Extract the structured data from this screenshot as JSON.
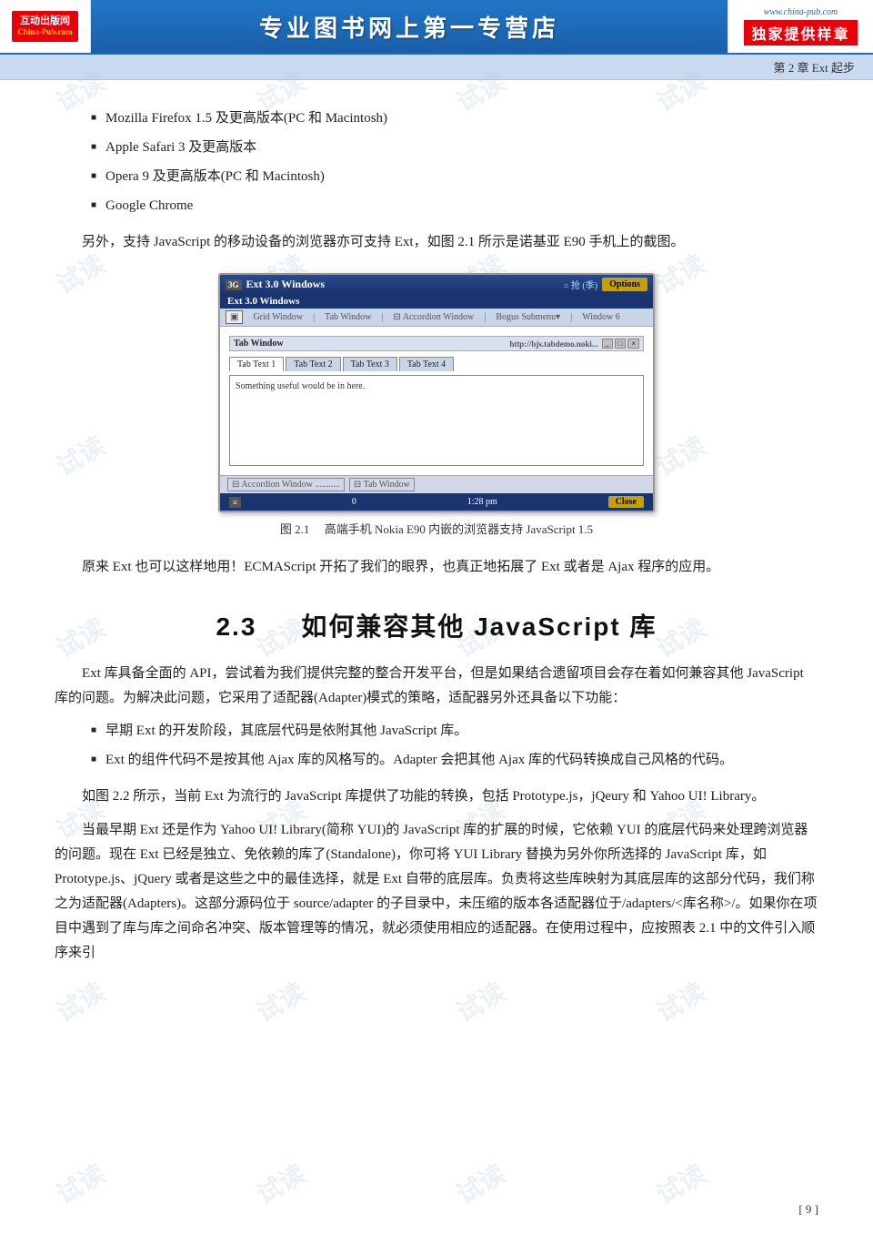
{
  "header": {
    "logo_line1": "互动出版网",
    "logo_line2": "China-Pub.com",
    "url": "www.china-pub.com",
    "title": "专业图书网上第一专营店",
    "slogan": "独家提供样章"
  },
  "chapter_bar": {
    "text": "第 2 章   Ext 起步"
  },
  "bullet_items": [
    "Mozilla Firefox 1.5 及更高版本(PC 和 Macintosh)",
    "Apple Safari 3 及更高版本",
    "Opera 9 及更高版本(PC 和 Macintosh)",
    "Google Chrome"
  ],
  "para1": "另外，支持 JavaScript 的移动设备的浏览器亦可支持 Ext，如图 2.1 所示是诺基亚 E90 手机上的截图。",
  "nokia": {
    "signal": "○ 抢 (季)",
    "title": "Ext 3.0 Windows",
    "options": "Options",
    "sub_header": "Ext 3.0 Windows",
    "nav_items": [
      "Grid Window",
      "Tab Window",
      "Accordion Window",
      "Bogus Submenu▾",
      "Window 6"
    ],
    "inner_title": "Tab Window",
    "url_bar": "http://bjs.tabdemo.noki...",
    "tabs": [
      "Tab Text 1",
      "Tab Text 2",
      "Tab Text 3",
      "Tab Text 4"
    ],
    "content": "Something useful would be in here.",
    "bottom_nav": [
      "Accordion Window",
      "Tab Window"
    ],
    "status_left": "0",
    "status_time": "1:28 pm",
    "close_btn": "Close"
  },
  "figure": {
    "label": "图 2.1",
    "caption": "高端手机 Nokia E90 内嵌的浏览器支持 JavaScript 1.5"
  },
  "para2": "原来 Ext 也可以这样地用！ECMAScript 开拓了我们的眼界，也真正地拓展了 Ext 或者是 Ajax 程序的应用。",
  "section": {
    "number": "2.3",
    "title": "如何兼容其他 JavaScript 库"
  },
  "para3": "Ext 库具备全面的 API，尝试着为我们提供完整的整合开发平台，但是如果结合遗留项目会存在着如何兼容其他 JavaScript 库的问题。为解决此问题，它采用了适配器(Adapter)模式的策略，适配器另外还具备以下功能：",
  "bullet2_items": [
    "早期 Ext 的开发阶段，其底层代码是依附其他 JavaScript 库。",
    "Ext 的组件代码不是按其他 Ajax 库的风格写的。Adapter 会把其他 Ajax 库的代码转换成自己风格的代码。"
  ],
  "para4": "如图 2.2 所示，当前 Ext 为流行的 JavaScript 库提供了功能的转换，包括 Prototype.js，jQeury 和 Yahoo UI! Library。",
  "para5": "当最早期 Ext 还是作为 Yahoo UI! Library(简称 YUI)的 JavaScript 库的扩展的时候，它依赖 YUI 的底层代码来处理跨浏览器的问题。现在 Ext 已经是独立、免依赖的库了(Standalone)，你可将 YUI Library 替换为另外你所选择的 JavaScript 库，如 Prototype.js、jQuery 或者是这些之中的最佳选择，就是 Ext 自带的底层库。负责将这些库映射为其底层库的这部分代码，我们称之为适配器(Adapters)。这部分源码位于 source/adapter 的子目录中，未压缩的版本各适配器位于/adapters/<库名称>/。如果你在项目中遇到了库与库之间命名冲突、版本管理等的情况，就必须使用相应的适配器。在使用过程中，应按照表 2.1 中的文件引入顺序来引",
  "page_number": "[ 9 ]",
  "watermarks": [
    "试读",
    "试读",
    "试读",
    "试读",
    "试读",
    "试读",
    "试读",
    "试读",
    "试读",
    "试读",
    "试读",
    "试读"
  ]
}
